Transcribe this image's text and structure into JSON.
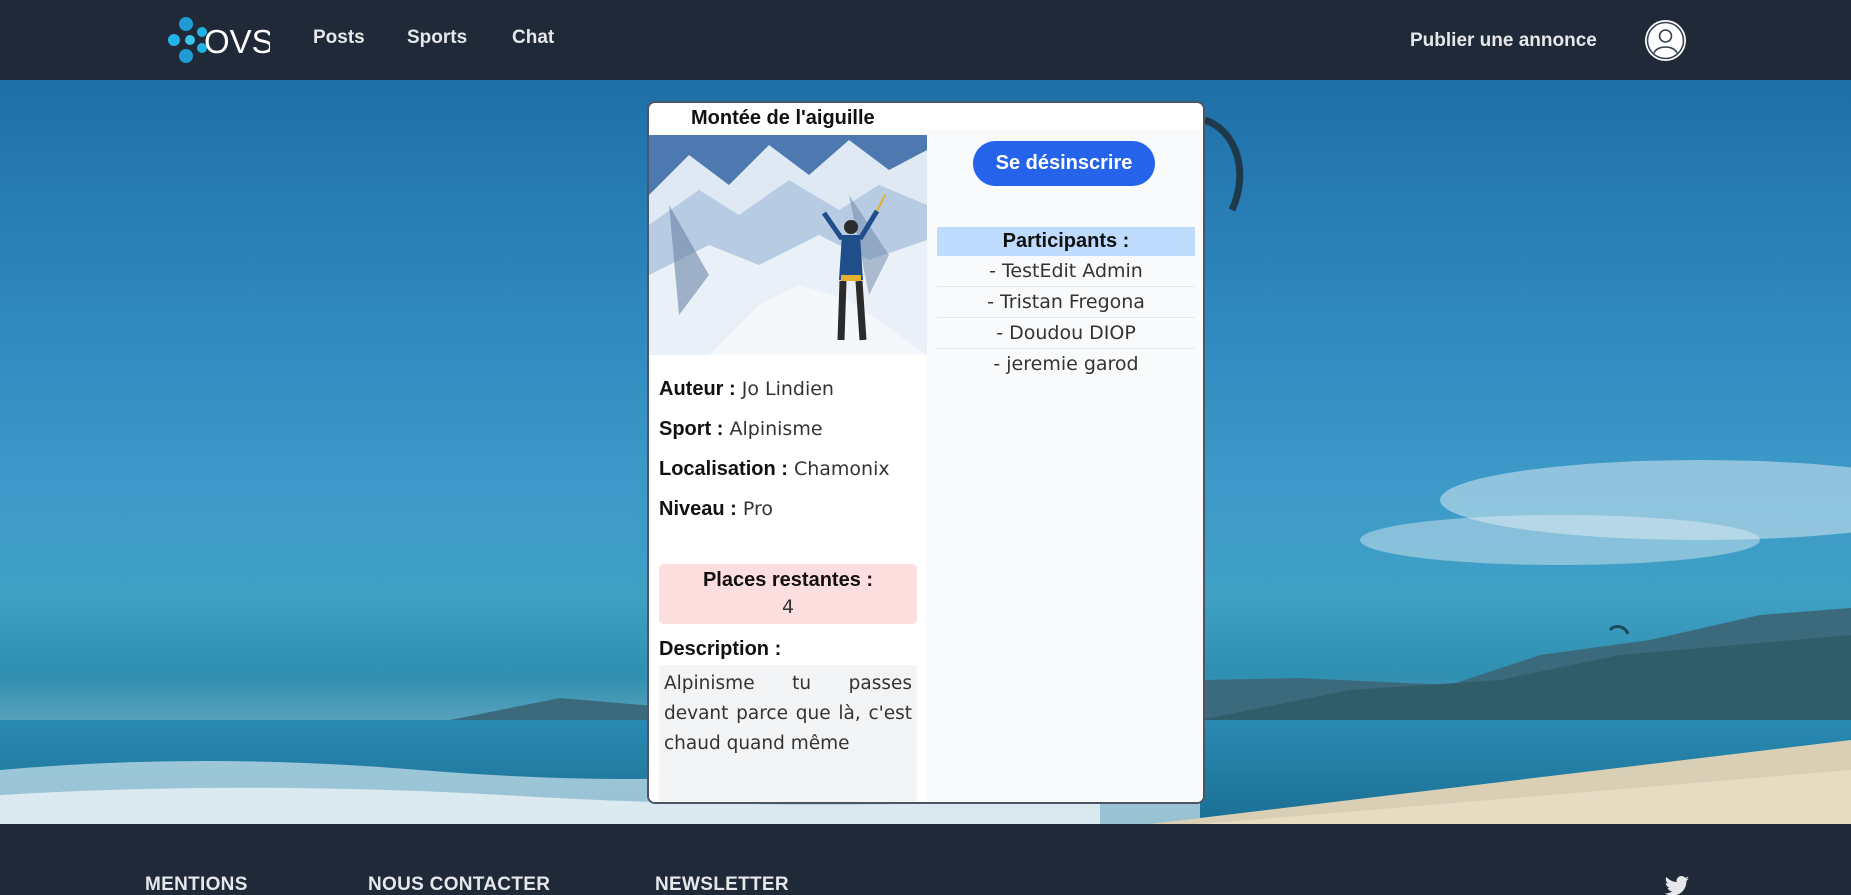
{
  "header": {
    "logo_text": "OVS",
    "nav": [
      {
        "label": "Posts"
      },
      {
        "label": "Sports"
      },
      {
        "label": "Chat"
      }
    ],
    "publish_label": "Publier une annonce"
  },
  "post": {
    "title": "Montée de l'aiguille",
    "author_label": "Auteur :",
    "author": "Jo Lindien",
    "sport_label": "Sport :",
    "sport": "Alpinisme",
    "location_label": "Localisation :",
    "location": "Chamonix",
    "level_label": "Niveau :",
    "level": "Pro",
    "places_label": "Places restantes :",
    "places": "4",
    "description_label": "Description :",
    "description": "Alpinisme tu passes devant parce que là, c'est chaud quand même",
    "unsubscribe_label": "Se désinscrire",
    "participants_label": "Participants :",
    "participants": [
      "- TestEdit Admin",
      "- Tristan Fregona",
      "- Doudou DIOP",
      "- jeremie garod"
    ]
  },
  "footer": {
    "mentions": "MENTIONS",
    "contact": "NOUS CONTACTER",
    "newsletter": "NEWSLETTER"
  },
  "colors": {
    "header_bg": "#1f2937",
    "primary_button": "#2563eb",
    "participants_header": "#bfdbfe",
    "places_bg": "#fddede"
  },
  "icons": {
    "avatar": "user-icon",
    "social": "twitter-icon"
  }
}
